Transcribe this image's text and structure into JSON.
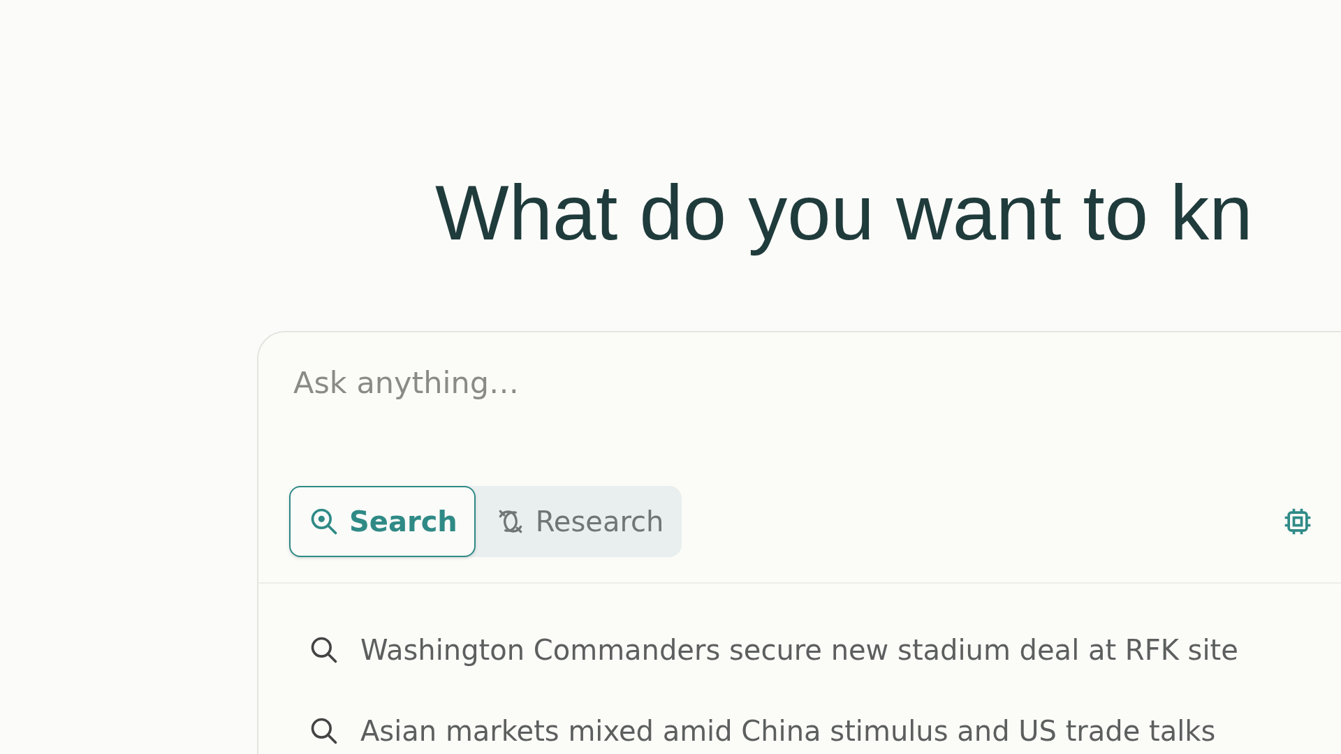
{
  "heading": "What do you want to kn",
  "search_box": {
    "placeholder": "Ask anything…"
  },
  "modes": [
    {
      "label": "Search",
      "kind": "search",
      "selected": true
    },
    {
      "label": "Research",
      "kind": "research",
      "selected": false
    }
  ],
  "suggestions": [
    {
      "text": "Washington Commanders secure new stadium deal at RFK site"
    },
    {
      "text": "Asian markets mixed amid China stimulus and US trade talks"
    }
  ]
}
